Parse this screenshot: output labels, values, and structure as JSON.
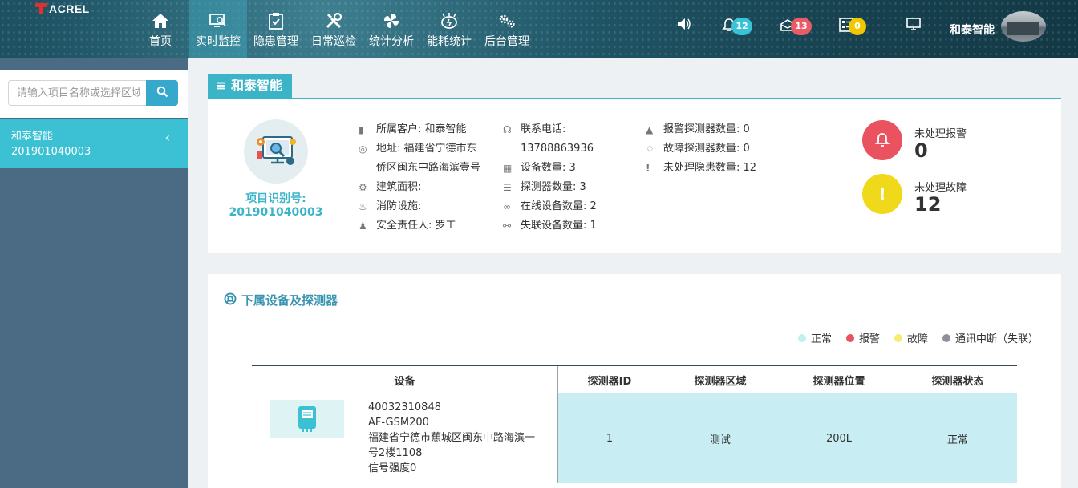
{
  "brand": {
    "name": "ACREL"
  },
  "nav": [
    {
      "label": "首页",
      "icon": "home-icon"
    },
    {
      "label": "实时监控",
      "icon": "monitor-search-icon",
      "active": true
    },
    {
      "label": "隐患管理",
      "icon": "clipboard-check-icon"
    },
    {
      "label": "日常巡检",
      "icon": "tools-icon"
    },
    {
      "label": "统计分析",
      "icon": "pinwheel-icon"
    },
    {
      "label": "能耗统计",
      "icon": "energy-icon"
    },
    {
      "label": "后台管理",
      "icon": "gears-icon"
    }
  ],
  "toolbar": {
    "sound_icon": "speaker-icon",
    "bell_count": "12",
    "mail_count": "13",
    "task_count": "0",
    "screen_icon": "monitor-icon",
    "user_name": "和泰智能"
  },
  "sidebar": {
    "search_placeholder": "请输入项目名称或选择区域",
    "projects": [
      {
        "name": "和泰智能",
        "code": "201901040003"
      }
    ]
  },
  "project": {
    "title_icon": "≡",
    "title": "和泰智能",
    "id_label": "项目识别号:",
    "id_value": "201901040003",
    "col1": [
      {
        "icon": "customer-icon",
        "text": "所属客户: 和泰智能"
      },
      {
        "icon": "location-icon",
        "text": "地址: 福建省宁德市东侨区闽东中路海滨壹号"
      },
      {
        "icon": "area-icon",
        "text": "建筑面积:"
      },
      {
        "icon": "fire-icon",
        "text": "消防设施:"
      },
      {
        "icon": "person-icon",
        "text": "安全责任人: 罗工"
      }
    ],
    "col2": [
      {
        "icon": "headset-icon",
        "text": "联系电话: 13788863936"
      },
      {
        "icon": "grid-icon",
        "text": "设备数量: 3"
      },
      {
        "icon": "sliders-icon",
        "text": "探测器数量: 3"
      },
      {
        "icon": "link-icon",
        "text": "在线设备数量: 2"
      },
      {
        "icon": "broken-link-icon",
        "text": "失联设备数量: 1"
      }
    ],
    "col3": [
      {
        "icon": "warning-icon",
        "text": "报警探测器数量: 0"
      },
      {
        "icon": "bell-outline-icon",
        "text": "故障探测器数量: 0"
      },
      {
        "icon": "exclamation-icon",
        "text": "未处理隐患数量: 12"
      }
    ],
    "stats": [
      {
        "label": "未处理报警",
        "value": "0",
        "color": "#e9525e",
        "icon": "bell-icon"
      },
      {
        "label": "未处理故障",
        "value": "12",
        "color": "#f0d81a",
        "icon": "exclamation-icon"
      }
    ]
  },
  "devices": {
    "title": "下属设备及探测器",
    "legend": [
      {
        "label": "正常",
        "color": "#c4eef4"
      },
      {
        "label": "报警",
        "color": "#e9525e"
      },
      {
        "label": "故障",
        "color": "#f5ec72"
      },
      {
        "label": "通讯中断（失联）",
        "color": "#8b9196"
      }
    ],
    "columns": [
      "设备",
      "探测器ID",
      "探测器区域",
      "探测器位置",
      "探测器状态"
    ],
    "rows": [
      {
        "device_id": "40032310848",
        "model": "AF-GSM200",
        "address": "福建省宁德市蕉城区闽东中路海滨一号2楼1108",
        "signal": "信号强度0",
        "detector_id": "1",
        "area": "测试",
        "position": "200L",
        "status": "正常"
      }
    ]
  }
}
